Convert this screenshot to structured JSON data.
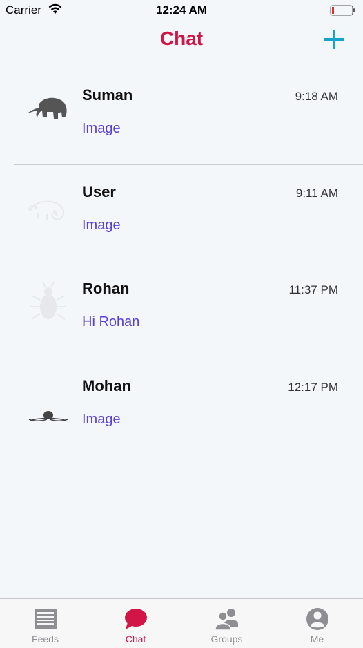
{
  "status_bar": {
    "carrier": "Carrier",
    "time": "12:24 AM"
  },
  "nav": {
    "title": "Chat",
    "add_icon": "plus-icon",
    "title_color": "#d21446",
    "accent_color": "#1aa3c8"
  },
  "chats": [
    {
      "name": "Suman",
      "time": "9:18 AM",
      "preview": "Image",
      "avatar": "elephant-icon"
    },
    {
      "name": "User",
      "time": "9:11 AM",
      "preview": "Image",
      "avatar": "chameleon-icon"
    },
    {
      "name": "Rohan",
      "time": "11:37 PM",
      "preview": "Hi Rohan",
      "avatar": "beetle-icon"
    },
    {
      "name": "Mohan",
      "time": "12:17 PM",
      "preview": "Image",
      "avatar": "octopus-icon"
    }
  ],
  "preview_color": "#5a3fd6",
  "tabs": [
    {
      "label": "Feeds",
      "icon": "feeds-icon",
      "active": false
    },
    {
      "label": "Chat",
      "icon": "chat-bubble-icon",
      "active": true
    },
    {
      "label": "Groups",
      "icon": "groups-icon",
      "active": false
    },
    {
      "label": "Me",
      "icon": "profile-icon",
      "active": false
    }
  ]
}
